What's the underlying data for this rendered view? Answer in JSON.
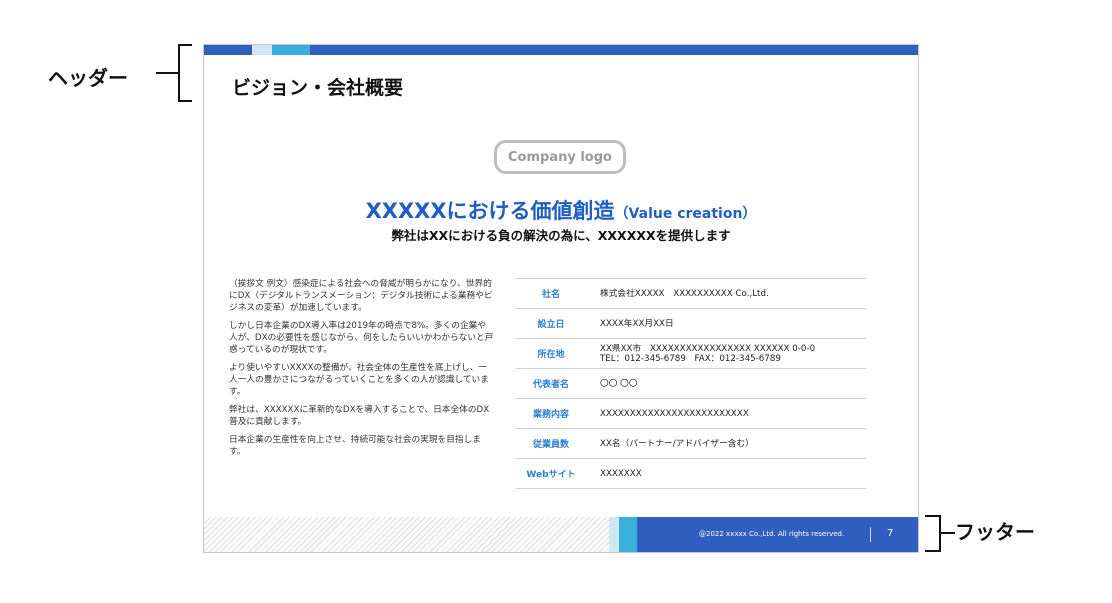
{
  "annotations": {
    "header_label": "ヘッダー",
    "footer_label": "フッター"
  },
  "slide": {
    "title": "ビジョン・会社概要",
    "logo_text": "Company logo",
    "headline_main": "XXXXXにおける価値創造",
    "headline_sub": "（Value creation）",
    "subheadline": "弊社はXXにおける負の解決の為に、XXXXXXを提供します",
    "body_paragraphs": [
      "（挨拶文 例文）感染症による社会への脅威が明らかになり、世界的にDX（デジタルトランスメーション：デジタル技術による業務やビジネスの変革）が加速しています。",
      "しかし日本企業のDX導入率は2019年の時点で8%。多くの企業や人が、DXの必要性を感じながら、何をしたらいいかわからないと戸惑っているのが現状です。",
      "より使いやすいXXXXの整備が、社会全体の生産性を底上げし、一人一人の豊かさにつながるっていくことを多くの人が認識しています。",
      "弊社は、XXXXXXに革新的なDXを導入することで、日本全体のDX普及に貢献します。",
      "日本企業の生産性を向上させ、持続可能な社会の実現を目指します。"
    ],
    "table": [
      {
        "label": "社名",
        "value": "株式会社XXXXX　XXXXXXXXXX Co.,Ltd."
      },
      {
        "label": "設立日",
        "value": "XXXX年XX月XX日"
      },
      {
        "label": "所在地",
        "value": "XX県XX市　XXXXXXXXXXXXXXXXX XXXXXX 0-0-0",
        "value2": "TEL：012-345-6789　FAX：012-345-6789"
      },
      {
        "label": "代表者名",
        "value": "〇〇 〇〇"
      },
      {
        "label": "業務内容",
        "value": "XXXXXXXXXXXXXXXXXXXXXXXXX"
      },
      {
        "label": "従業員数",
        "value": "XX名（パートナー/アドバイザー含む）"
      },
      {
        "label": "Webサイト",
        "value": "XXXXXXX"
      }
    ],
    "footer": {
      "copyright": "@2022 xxxxx Co.,Ltd. All rights reserved.",
      "page_number": "7"
    }
  },
  "colors": {
    "brand_blue": "#2f5fbf",
    "accent_cyan": "#39b0dc",
    "light_cyan": "#cfe6f5",
    "headline_blue": "#1f5fc2",
    "label_blue": "#2a7fd0"
  }
}
